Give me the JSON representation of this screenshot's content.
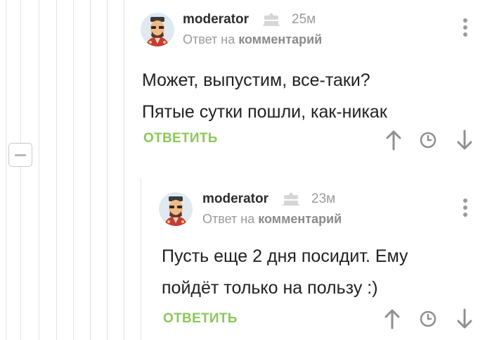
{
  "comments": [
    {
      "author": "moderator",
      "time": "25м",
      "reply_prefix": "Ответ на",
      "reply_link": "комментарий",
      "lines": [
        "Может, выпустим, все-таки?",
        "Пятые сутки пошли, как-никак"
      ],
      "reply_label": "ОТВЕТИТЬ"
    },
    {
      "author": "moderator",
      "time": "23м",
      "reply_prefix": "Ответ на",
      "reply_link": "комментарий",
      "lines": [
        "Пусть еще 2 дня посидит. Ему",
        "пойдёт только на пользу :)"
      ],
      "reply_label": "ОТВЕТИТЬ"
    }
  ],
  "icons": {
    "avatar": "moderator-avatar",
    "badge": "cake-icon",
    "menu": "more-vertical-icon",
    "up": "arrow-up-icon",
    "clock": "clock-icon",
    "down": "arrow-down-icon",
    "collapse": "collapse-minus-icon"
  },
  "colors": {
    "accent": "#8ac858",
    "muted": "#9a9a9a",
    "text": "#222222"
  }
}
